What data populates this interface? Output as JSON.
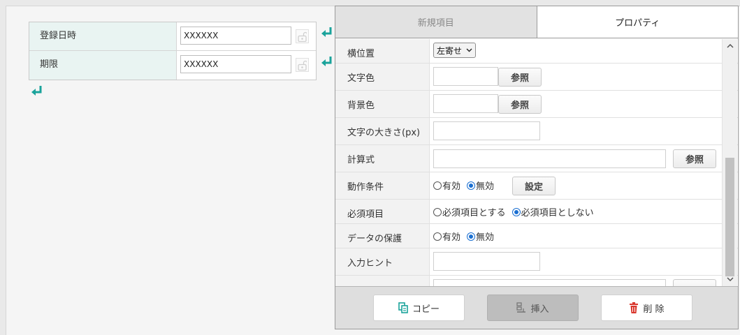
{
  "form": {
    "rows": [
      {
        "label": "登録日時",
        "value": "XXXXXX"
      },
      {
        "label": "期限",
        "value": "XXXXXX"
      }
    ]
  },
  "panel": {
    "tabs": [
      {
        "label": "新規項目",
        "active": false
      },
      {
        "label": "プロパティ",
        "active": true
      }
    ],
    "properties": {
      "h_position": {
        "label": "横位置",
        "select_value": "左寄せ"
      },
      "text_color": {
        "label": "文字色",
        "button": "参照"
      },
      "bg_color": {
        "label": "背景色",
        "button": "参照"
      },
      "font_size": {
        "label": "文字の大きさ(px)"
      },
      "formula": {
        "label": "計算式",
        "button": "参照"
      },
      "action_condition": {
        "label": "動作条件",
        "opt_on": "有効",
        "opt_off": "無効",
        "selected": "無効",
        "button": "設定"
      },
      "required": {
        "label": "必須項目",
        "opt_on": "必須項目とする",
        "opt_off": "必須項目としない",
        "selected": "必須項目としない"
      },
      "protection": {
        "label": "データの保護",
        "opt_on": "有効",
        "opt_off": "無効",
        "selected": "無効"
      },
      "input_hint": {
        "label": "入力ヒント"
      }
    },
    "footer": {
      "copy_label": "コピー",
      "insert_label": "挿入",
      "delete_label": "削 除"
    }
  },
  "colors": {
    "accent_teal": "#1aa39b",
    "label_bg": "#e9f4f2",
    "delete_red": "#d9362c",
    "radio_blue": "#1a6fd1"
  }
}
